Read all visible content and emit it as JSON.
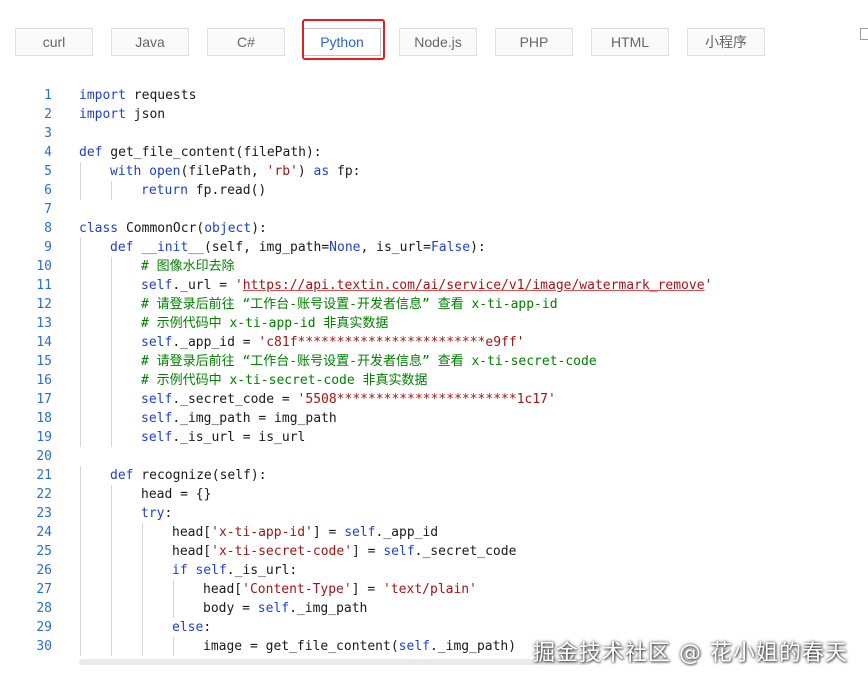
{
  "tabs": [
    {
      "label": "curl"
    },
    {
      "label": "Java"
    },
    {
      "label": "C#"
    },
    {
      "label": "Python",
      "active": true
    },
    {
      "label": "Node.js"
    },
    {
      "label": "PHP"
    },
    {
      "label": "HTML"
    },
    {
      "label": "小程序"
    }
  ],
  "code": {
    "lines": [
      {
        "n": "1",
        "indent": 0,
        "tokens": [
          [
            "kw",
            "import"
          ],
          [
            "t",
            " requests"
          ]
        ]
      },
      {
        "n": "2",
        "indent": 0,
        "tokens": [
          [
            "kw",
            "import"
          ],
          [
            "t",
            " json"
          ]
        ]
      },
      {
        "n": "3",
        "indent": 0,
        "tokens": []
      },
      {
        "n": "4",
        "indent": 0,
        "tokens": [
          [
            "kw",
            "def"
          ],
          [
            "t",
            " get_file_content(filePath):"
          ]
        ]
      },
      {
        "n": "5",
        "indent": 1,
        "tokens": [
          [
            "kw",
            "with"
          ],
          [
            "t",
            " "
          ],
          [
            "kw",
            "open"
          ],
          [
            "t",
            "(filePath, "
          ],
          [
            "str",
            "'rb'"
          ],
          [
            "t",
            ") "
          ],
          [
            "kw",
            "as"
          ],
          [
            "t",
            " fp:"
          ]
        ]
      },
      {
        "n": "6",
        "indent": 2,
        "tokens": [
          [
            "kw",
            "return"
          ],
          [
            "t",
            " fp.read()"
          ]
        ]
      },
      {
        "n": "7",
        "indent": 0,
        "tokens": []
      },
      {
        "n": "8",
        "indent": 0,
        "tokens": [
          [
            "kw",
            "class"
          ],
          [
            "t",
            " CommonOcr("
          ],
          [
            "kw",
            "object"
          ],
          [
            "t",
            "):"
          ]
        ]
      },
      {
        "n": "9",
        "indent": 1,
        "tokens": [
          [
            "kw",
            "def"
          ],
          [
            "t",
            " "
          ],
          [
            "kw",
            "__init__"
          ],
          [
            "t",
            "(self, img_path="
          ],
          [
            "kw",
            "None"
          ],
          [
            "t",
            ", is_url="
          ],
          [
            "kw",
            "False"
          ],
          [
            "t",
            "):"
          ]
        ]
      },
      {
        "n": "10",
        "indent": 2,
        "tokens": [
          [
            "cm",
            "# 图像水印去除"
          ]
        ]
      },
      {
        "n": "11",
        "indent": 2,
        "tokens": [
          [
            "kw",
            "self"
          ],
          [
            "t",
            "._url = "
          ],
          [
            "str",
            "'"
          ],
          [
            "url",
            "https://api.textin.com/ai/service/v1/image/watermark_remove"
          ],
          [
            "str",
            "'"
          ]
        ]
      },
      {
        "n": "12",
        "indent": 2,
        "tokens": [
          [
            "cm",
            "# 请登录后前往 “工作台-账号设置-开发者信息” 查看 x-ti-app-id"
          ]
        ]
      },
      {
        "n": "13",
        "indent": 2,
        "tokens": [
          [
            "cm",
            "# 示例代码中 x-ti-app-id 非真实数据"
          ]
        ]
      },
      {
        "n": "14",
        "indent": 2,
        "tokens": [
          [
            "kw",
            "self"
          ],
          [
            "t",
            "._app_id = "
          ],
          [
            "str",
            "'c81f************************e9ff'"
          ]
        ]
      },
      {
        "n": "15",
        "indent": 2,
        "tokens": [
          [
            "cm",
            "# 请登录后前往 “工作台-账号设置-开发者信息” 查看 x-ti-secret-code"
          ]
        ]
      },
      {
        "n": "16",
        "indent": 2,
        "tokens": [
          [
            "cm",
            "# 示例代码中 x-ti-secret-code 非真实数据"
          ]
        ]
      },
      {
        "n": "17",
        "indent": 2,
        "tokens": [
          [
            "kw",
            "self"
          ],
          [
            "t",
            "._secret_code = "
          ],
          [
            "str",
            "'5508***********************1c17'"
          ]
        ]
      },
      {
        "n": "18",
        "indent": 2,
        "tokens": [
          [
            "kw",
            "self"
          ],
          [
            "t",
            "._img_path = img_path"
          ]
        ]
      },
      {
        "n": "19",
        "indent": 2,
        "tokens": [
          [
            "kw",
            "self"
          ],
          [
            "t",
            "._is_url = is_url"
          ]
        ]
      },
      {
        "n": "20",
        "indent": 0,
        "tokens": []
      },
      {
        "n": "21",
        "indent": 1,
        "tokens": [
          [
            "kw",
            "def"
          ],
          [
            "t",
            " recognize(self):"
          ]
        ]
      },
      {
        "n": "22",
        "indent": 2,
        "tokens": [
          [
            "t",
            "head = {}"
          ]
        ]
      },
      {
        "n": "23",
        "indent": 2,
        "tokens": [
          [
            "kw",
            "try"
          ],
          [
            "t",
            ":"
          ]
        ]
      },
      {
        "n": "24",
        "indent": 3,
        "tokens": [
          [
            "t",
            "head["
          ],
          [
            "str",
            "'x-ti-app-id'"
          ],
          [
            "t",
            "] = "
          ],
          [
            "kw",
            "self"
          ],
          [
            "t",
            "._app_id"
          ]
        ]
      },
      {
        "n": "25",
        "indent": 3,
        "tokens": [
          [
            "t",
            "head["
          ],
          [
            "str",
            "'x-ti-secret-code'"
          ],
          [
            "t",
            "] = "
          ],
          [
            "kw",
            "self"
          ],
          [
            "t",
            "._secret_code"
          ]
        ]
      },
      {
        "n": "26",
        "indent": 3,
        "tokens": [
          [
            "kw",
            "if"
          ],
          [
            "t",
            " "
          ],
          [
            "kw",
            "self"
          ],
          [
            "t",
            "._is_url:"
          ]
        ]
      },
      {
        "n": "27",
        "indent": 4,
        "tokens": [
          [
            "t",
            "head["
          ],
          [
            "str",
            "'Content-Type'"
          ],
          [
            "t",
            "] = "
          ],
          [
            "str",
            "'text/plain'"
          ]
        ]
      },
      {
        "n": "28",
        "indent": 4,
        "tokens": [
          [
            "t",
            "body = "
          ],
          [
            "kw",
            "self"
          ],
          [
            "t",
            "._img_path"
          ]
        ]
      },
      {
        "n": "29",
        "indent": 3,
        "tokens": [
          [
            "kw",
            "else"
          ],
          [
            "t",
            ":"
          ]
        ]
      },
      {
        "n": "30",
        "indent": 4,
        "tokens": [
          [
            "t",
            "image = get_file_content("
          ],
          [
            "kw",
            "self"
          ],
          [
            "t",
            "._img_path)"
          ]
        ]
      }
    ]
  },
  "watermark": "掘金技术社区 @ 花小姐的春天",
  "colors": {
    "accent": "#2a63d6",
    "highlight": "#e02020",
    "keyword": "#1f3fd1",
    "string": "#a31515",
    "comment": "#008000"
  }
}
